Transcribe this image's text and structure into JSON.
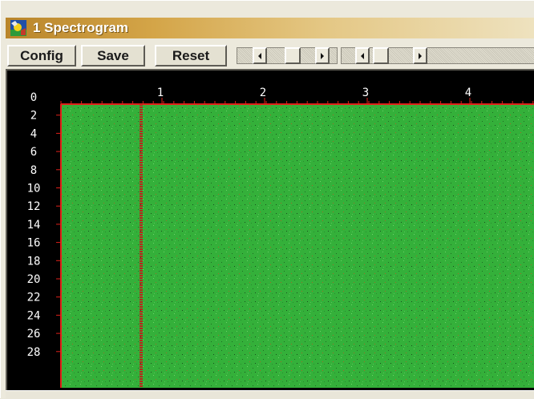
{
  "window": {
    "title": "1 Spectrogram"
  },
  "toolbar": {
    "config_label": "Config",
    "save_label": "Save",
    "reset_label": "Reset"
  },
  "plot": {
    "x_ticks": [
      "1",
      "2",
      "3",
      "4"
    ],
    "y_ticks": [
      "0",
      "2",
      "4",
      "6",
      "8",
      "10",
      "12",
      "14",
      "16",
      "18",
      "20",
      "22",
      "24",
      "26",
      "28"
    ],
    "colors": {
      "background": "#000000",
      "field": "#34b03a",
      "axis": "#e0201a",
      "text": "#ffffff"
    }
  }
}
